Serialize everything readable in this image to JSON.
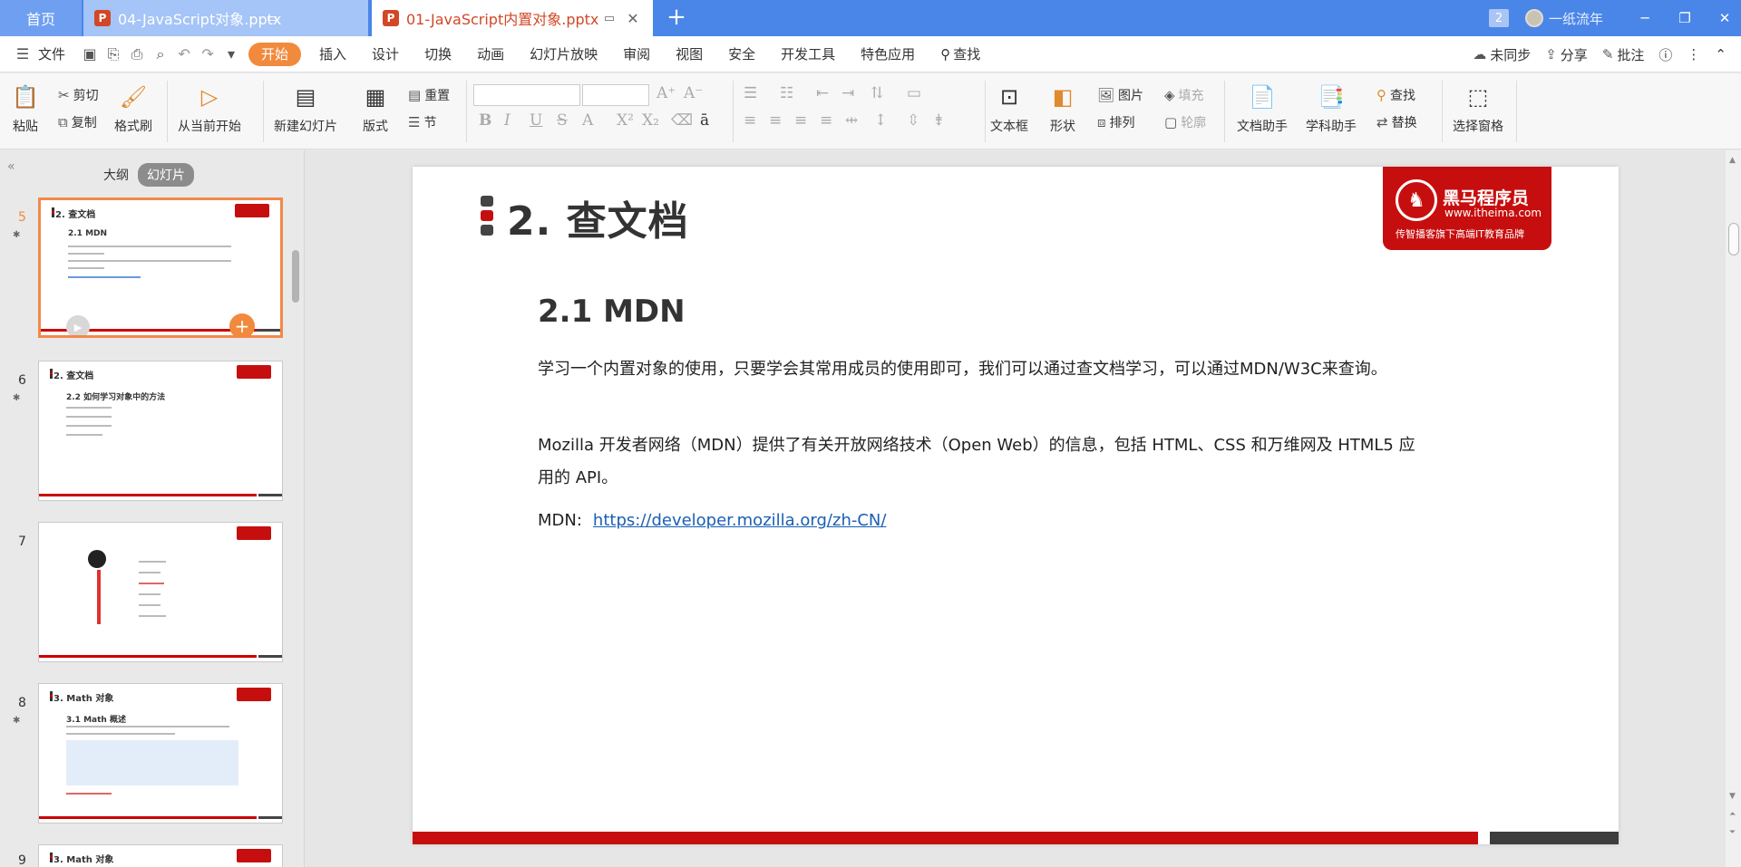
{
  "titlebar": {
    "home_tab": "首页",
    "file_tabs": [
      {
        "badge": "P",
        "name": "04-JavaScript对象.pptx",
        "active": false
      },
      {
        "badge": "P",
        "name": "01-JavaScript内置对象.pptx",
        "active": true
      }
    ],
    "add_tab": "+",
    "window_count": "2",
    "user_name": "一纸流年"
  },
  "menubar": {
    "file_menu": "文件",
    "tabs": [
      "开始",
      "插入",
      "设计",
      "切换",
      "动画",
      "幻灯片放映",
      "审阅",
      "视图",
      "安全",
      "开发工具",
      "特色应用"
    ],
    "search": "查找",
    "right": {
      "sync": "未同步",
      "share": "分享",
      "comment": "批注"
    }
  },
  "ribbon": {
    "paste": "粘贴",
    "cut": "剪切",
    "copy": "复制",
    "format_painter": "格式刷",
    "from_current": "从当前开始",
    "new_slide": "新建幻灯片",
    "layout": "版式",
    "reset": "重置",
    "section": "节",
    "textbox": "文本框",
    "shape": "形状",
    "picture": "图片",
    "fill": "填充",
    "arrange": "排列",
    "outline": "轮廓",
    "doc_assistant": "文档助手",
    "subject_assistant": "学科助手",
    "find": "查找",
    "replace": "替换",
    "selection_pane": "选择窗格"
  },
  "left_panel": {
    "view_tabs": [
      "大纲",
      "幻灯片"
    ],
    "thumbnails": [
      {
        "number": "5",
        "title": "2. 查文档",
        "subtitle": "2.1 MDN",
        "selected": true
      },
      {
        "number": "6",
        "title": "2. 查文档",
        "subtitle": "2.2 如何学习对象中的方法",
        "selected": false
      },
      {
        "number": "7",
        "title": "",
        "subtitle": "",
        "selected": false
      },
      {
        "number": "8",
        "title": "3. Math 对象",
        "subtitle": "3.1 Math 概述",
        "selected": false
      },
      {
        "number": "9",
        "title": "3. Math 对象",
        "subtitle": "",
        "selected": false
      }
    ]
  },
  "slide": {
    "title": "2. 查文档",
    "logo": {
      "brand": "黑马程序员",
      "url": "www.itheima.com",
      "slogan": "传智播客旗下高端IT教育品牌"
    },
    "subtitle": "2.1 MDN",
    "paragraph1": "学习一个内置对象的使用，只要学会其常用成员的使用即可，我们可以通过查文档学习，可以通过MDN/W3C来查询。",
    "paragraph2": "Mozilla 开发者网络（MDN）提供了有关开放网络技术（Open Web）的信息，包括 HTML、CSS 和万维网及 HTML5 应用的 API。",
    "mdn_label": "MDN:",
    "mdn_link": "https://developer.mozilla.org/zh-CN/"
  },
  "colors": {
    "titlebar": "#4a86e8",
    "accent_orange": "#f18a3c",
    "brand_red": "#c70e0e",
    "link_blue": "#1a5fb4"
  }
}
